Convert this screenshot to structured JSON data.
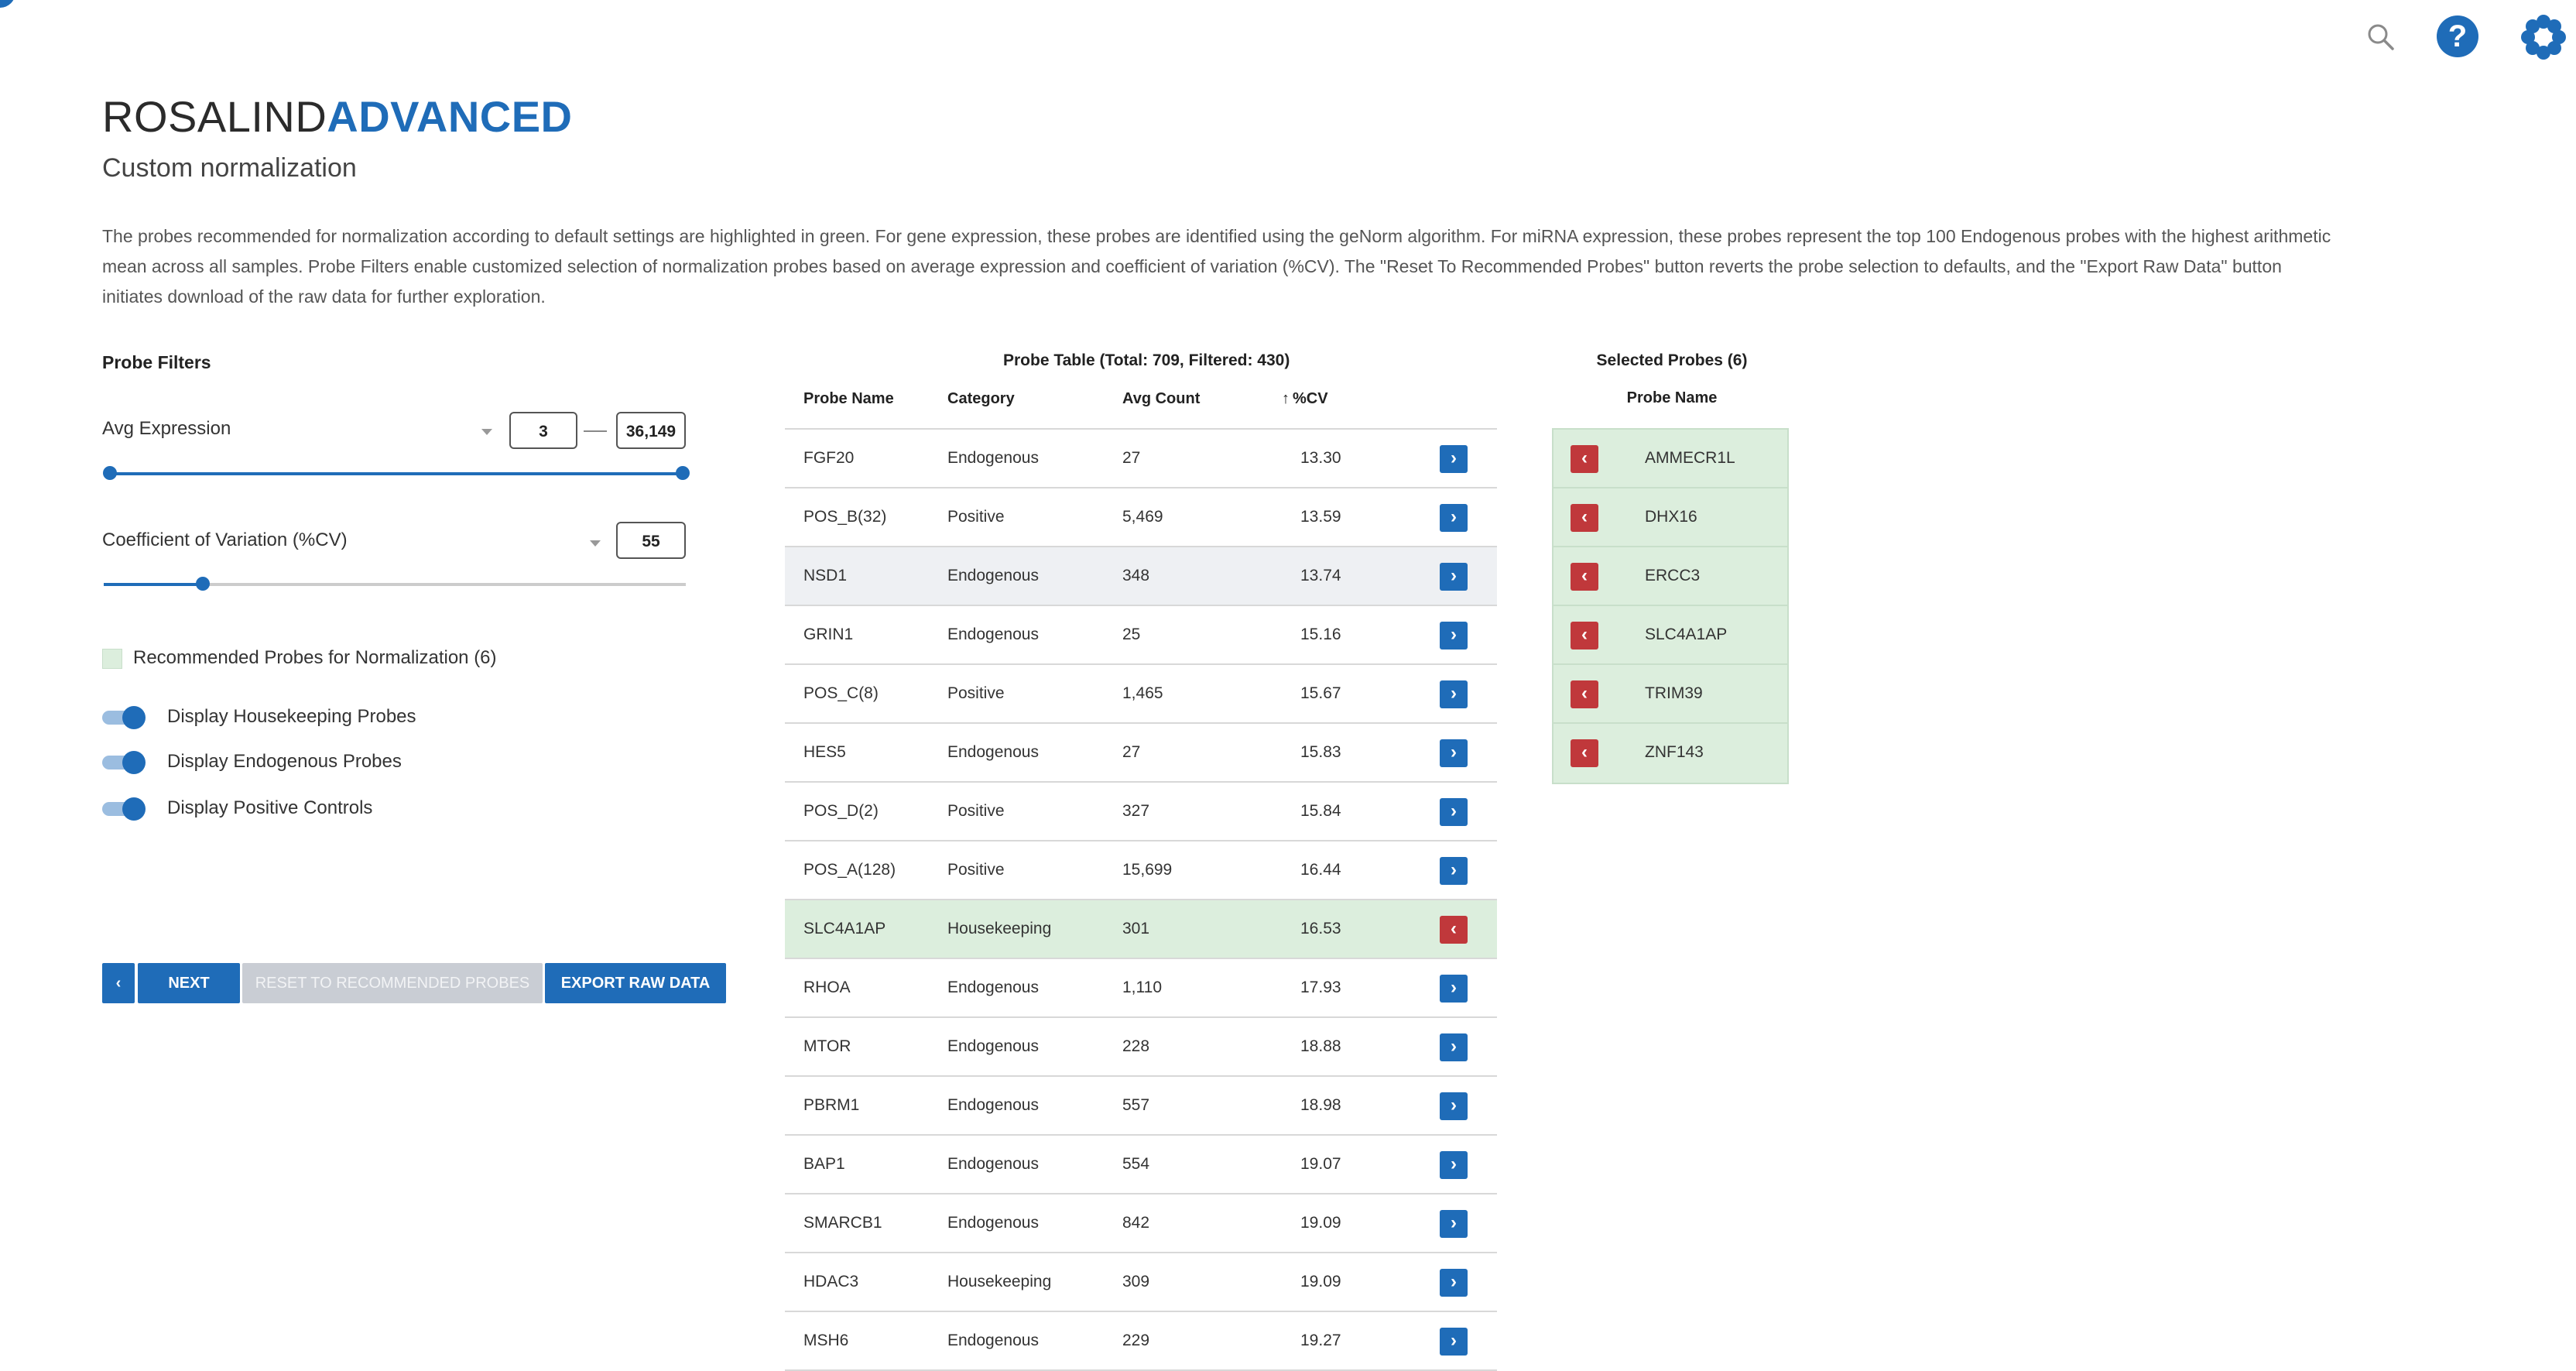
{
  "brand": {
    "light": "ROSALIND",
    "bold": "ADVANCED"
  },
  "subtitle": "Custom normalization",
  "description": "The probes recommended for normalization according to default settings are highlighted in green. For gene expression, these probes are identified using the geNorm algorithm. For miRNA expression, these probes represent the top 100 Endogenous probes with the highest arithmetic mean across all samples. Probe Filters enable customized selection of normalization probes based on average expression and coefficient of variation (%CV). The \"Reset To Recommended Probes\" button reverts the probe selection to defaults, and the \"Export Raw Data\" button initiates download of the raw data for further exploration.",
  "filters": {
    "title": "Probe Filters",
    "avg_expression": {
      "label": "Avg Expression",
      "min": "3",
      "max": "36,149",
      "fill_fraction_start": 0.0,
      "fill_fraction_end": 1.0
    },
    "cv": {
      "label": "Coefficient of Variation (%CV)",
      "value": "55",
      "fill_fraction": 0.17
    },
    "legend_label": "Recommended Probes for Normalization (6)",
    "toggles": [
      {
        "label": "Display Housekeeping Probes",
        "on": true
      },
      {
        "label": "Display Endogenous Probes",
        "on": true
      },
      {
        "label": "Display Positive Controls",
        "on": true
      }
    ]
  },
  "buttons": {
    "back": "‹",
    "next": "NEXT",
    "reset": "RESET TO RECOMMENDED PROBES",
    "export": "EXPORT RAW DATA"
  },
  "probe_table": {
    "title": "Probe Table (Total: 709, Filtered: 430)",
    "headers": {
      "name": "Probe Name",
      "category": "Category",
      "avg": "Avg Count",
      "cv": "%CV"
    },
    "rows": [
      {
        "name": "FGF20",
        "category": "Endogenous",
        "avg": "27",
        "cv": "13.30",
        "selected": false
      },
      {
        "name": "POS_B(32)",
        "category": "Positive",
        "avg": "5,469",
        "cv": "13.59",
        "selected": false
      },
      {
        "name": "NSD1",
        "category": "Endogenous",
        "avg": "348",
        "cv": "13.74",
        "selected": false
      },
      {
        "name": "GRIN1",
        "category": "Endogenous",
        "avg": "25",
        "cv": "15.16",
        "selected": false
      },
      {
        "name": "POS_C(8)",
        "category": "Positive",
        "avg": "1,465",
        "cv": "15.67",
        "selected": false
      },
      {
        "name": "HES5",
        "category": "Endogenous",
        "avg": "27",
        "cv": "15.83",
        "selected": false
      },
      {
        "name": "POS_D(2)",
        "category": "Positive",
        "avg": "327",
        "cv": "15.84",
        "selected": false
      },
      {
        "name": "POS_A(128)",
        "category": "Positive",
        "avg": "15,699",
        "cv": "16.44",
        "selected": false
      },
      {
        "name": "SLC4A1AP",
        "category": "Housekeeping",
        "avg": "301",
        "cv": "16.53",
        "selected": true
      },
      {
        "name": "RHOA",
        "category": "Endogenous",
        "avg": "1,110",
        "cv": "17.93",
        "selected": false
      },
      {
        "name": "MTOR",
        "category": "Endogenous",
        "avg": "228",
        "cv": "18.88",
        "selected": false
      },
      {
        "name": "PBRM1",
        "category": "Endogenous",
        "avg": "557",
        "cv": "18.98",
        "selected": false
      },
      {
        "name": "BAP1",
        "category": "Endogenous",
        "avg": "554",
        "cv": "19.07",
        "selected": false
      },
      {
        "name": "SMARCB1",
        "category": "Endogenous",
        "avg": "842",
        "cv": "19.09",
        "selected": false
      },
      {
        "name": "HDAC3",
        "category": "Housekeeping",
        "avg": "309",
        "cv": "19.09",
        "selected": false
      },
      {
        "name": "MSH6",
        "category": "Endogenous",
        "avg": "229",
        "cv": "19.27",
        "selected": false
      }
    ]
  },
  "selected_probes": {
    "title": "Selected Probes (6)",
    "header": "Probe Name",
    "items": [
      "AMMECR1L",
      "DHX16",
      "ERCC3",
      "SLC4A1AP",
      "TRIM39",
      "ZNF143"
    ]
  },
  "icons": {
    "add": "›",
    "remove": "‹",
    "help": "?"
  },
  "colors": {
    "accent": "#1f6cb8",
    "remove": "#c0383b",
    "recommended": "#dceedd"
  }
}
